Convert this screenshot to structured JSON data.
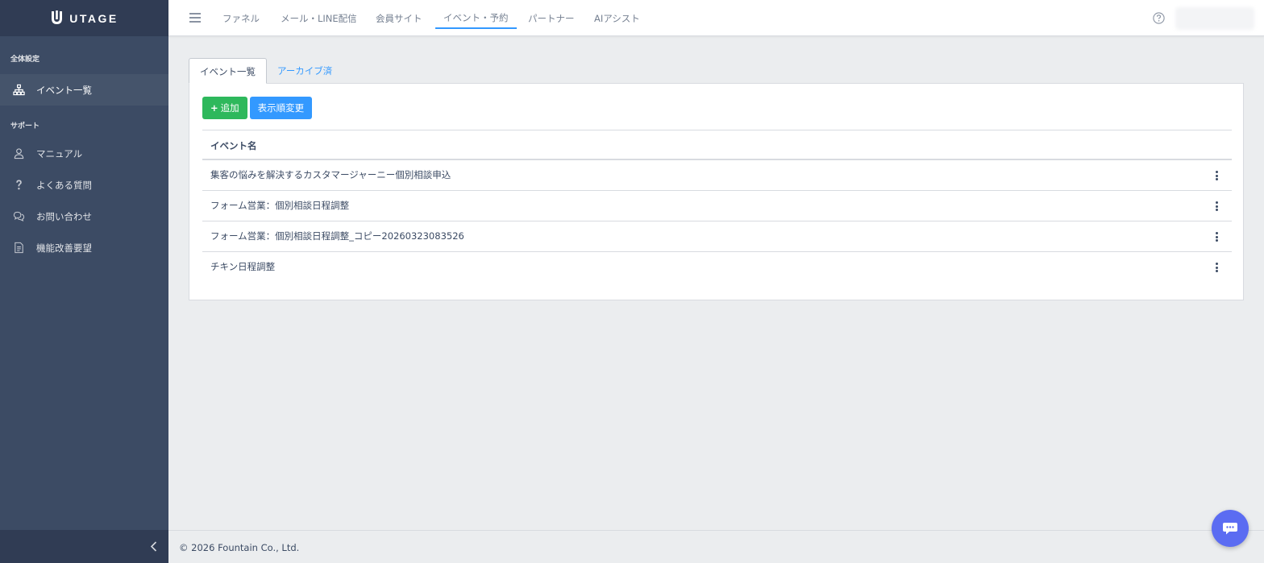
{
  "brand": {
    "name": "UTAGE"
  },
  "sidebar": {
    "sections": [
      {
        "title": "全体設定",
        "items": [
          {
            "label": "イベント一覧",
            "icon": "sitemap-icon",
            "active": true
          }
        ]
      },
      {
        "title": "サポート",
        "items": [
          {
            "label": "マニュアル",
            "icon": "user-icon"
          },
          {
            "label": "よくある質問",
            "icon": "question-icon"
          },
          {
            "label": "お問い合わせ",
            "icon": "chat-icon"
          },
          {
            "label": "機能改善要望",
            "icon": "document-icon"
          }
        ]
      }
    ]
  },
  "header": {
    "tabs": [
      {
        "label": "ファネル"
      },
      {
        "label": "メール・LINE配信"
      },
      {
        "label": "会員サイト"
      },
      {
        "label": "イベント・予約",
        "active": true
      },
      {
        "label": "パートナー"
      },
      {
        "label": "AIアシスト"
      }
    ]
  },
  "page": {
    "tabs": [
      {
        "label": "イベント一覧",
        "active": true
      },
      {
        "label": "アーカイブ済"
      }
    ],
    "buttons": {
      "add": "追加",
      "reorder": "表示順変更"
    },
    "table": {
      "header": "イベント名",
      "rows": [
        "集客の悩みを解決するカスタマージャーニー個別相談申込",
        "フォーム営業：個別相談日程調整",
        "フォーム営業：個別相談日程調整_コピー20260323083526",
        "チキン日程調整"
      ]
    }
  },
  "footer": {
    "text": "© 2026 Fountain Co., Ltd."
  },
  "colors": {
    "sidebar": "#3c4b64",
    "primary": "#3399ff",
    "success": "#2eb85c",
    "chat": "#5b6cf2"
  }
}
